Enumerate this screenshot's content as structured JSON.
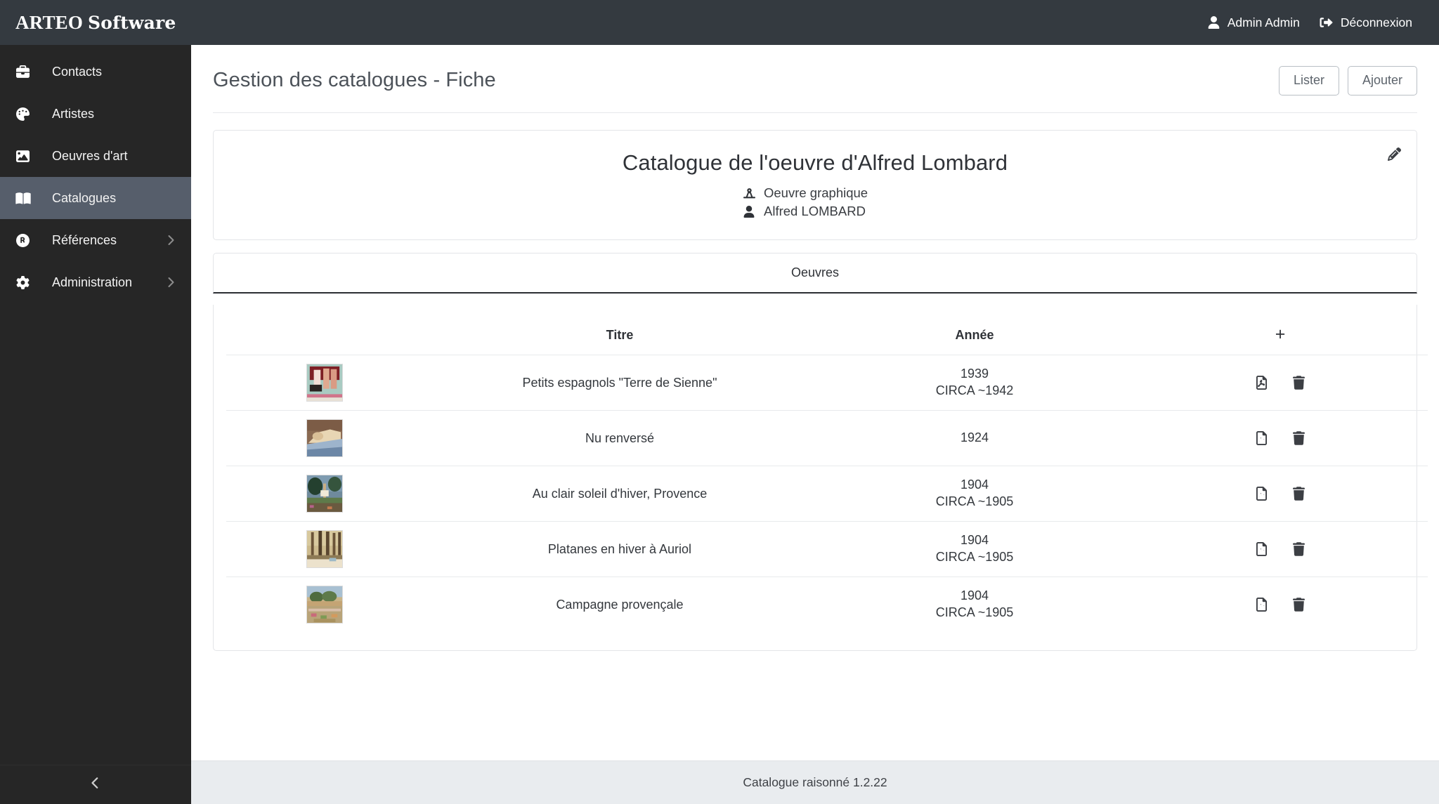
{
  "topbar": {
    "brand_main": "ARTEO",
    "brand_sub": "Software",
    "user_name": "Admin Admin",
    "logout_label": "Déconnexion",
    "user_icon": "user-icon",
    "logout_icon": "sign-out-icon",
    "bg_color": "#343a40"
  },
  "sidebar": {
    "bg_color": "#262626",
    "active_color": "#565e6b",
    "collapse_icon": "chevron-left-icon",
    "items": [
      {
        "label": "Contacts",
        "icon": "briefcase-icon",
        "active": false,
        "has_chevron": false
      },
      {
        "label": "Artistes",
        "icon": "palette-icon",
        "active": false,
        "has_chevron": false
      },
      {
        "label": "Oeuvres d'art",
        "icon": "image-icon",
        "active": false,
        "has_chevron": false
      },
      {
        "label": "Catalogues",
        "icon": "book-icon",
        "active": true,
        "has_chevron": false
      },
      {
        "label": "Références",
        "icon": "registered-icon",
        "active": false,
        "has_chevron": true
      },
      {
        "label": "Administration",
        "icon": "gear-icon",
        "active": false,
        "has_chevron": true
      }
    ]
  },
  "page": {
    "title": "Gestion des catalogues - Fiche",
    "actions": [
      {
        "label": "Lister"
      },
      {
        "label": "Ajouter"
      }
    ]
  },
  "catalogue": {
    "title": "Catalogue de l'oeuvre d'Alfred Lombard",
    "type_label": "Oeuvre graphique",
    "type_icon": "compass-drafting-icon",
    "artist_label": "Alfred LOMBARD",
    "artist_icon": "user-solid-icon",
    "edit_icon": "pencil-icon"
  },
  "tabs": [
    {
      "label": "Oeuvres",
      "active": true
    }
  ],
  "table": {
    "headers": {
      "thumb": "",
      "titre": "Titre",
      "annee": "Année",
      "add": "+"
    },
    "add_icon": "plus-icon",
    "pdf_icon": "file-pdf-icon",
    "delete_icon": "trash-icon",
    "rows": [
      {
        "titre": "Petits espagnols \"Terre de Sienne\"",
        "annee": "1939",
        "annee_circa": "CIRCA ~1942",
        "thumb_colors": [
          "#8c2b2b",
          "#e8c6bc",
          "#d79a8a",
          "#9ec7bf",
          "#f0e3d8"
        ]
      },
      {
        "titre": "Nu renversé",
        "annee": "1924",
        "annee_circa": "",
        "thumb_colors": [
          "#8a6a55",
          "#e6d5b8",
          "#d9c4a2",
          "#9fb5cc",
          "#6f8aa8"
        ]
      },
      {
        "titre": "Au clair soleil d'hiver, Provence",
        "annee": "1904",
        "annee_circa": "CIRCA ~1905",
        "thumb_colors": [
          "#4a6b7a",
          "#2f4a3a",
          "#8aa07a",
          "#6b5a48",
          "#b7a27e"
        ]
      },
      {
        "titre": "Platanes en hiver à Auriol",
        "annee": "1904",
        "annee_circa": "CIRCA ~1905",
        "thumb_colors": [
          "#c8b98e",
          "#5b4a38",
          "#8a7a5e",
          "#e0d6c0",
          "#7d8f6a"
        ]
      },
      {
        "titre": "Campagne provençale",
        "annee": "1904",
        "annee_circa": "CIRCA ~1905",
        "thumb_colors": [
          "#9fb8c9",
          "#5f7a4d",
          "#c9b07e",
          "#8a9a6a",
          "#d8c9a8"
        ]
      }
    ]
  },
  "footer": {
    "text": "Catalogue raisonné 1.2.22"
  }
}
